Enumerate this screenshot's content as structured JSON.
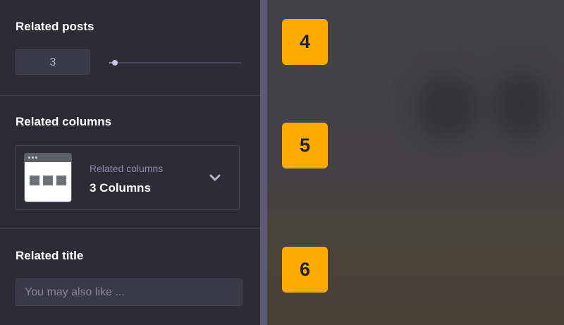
{
  "sections": {
    "related_posts": {
      "heading": "Related posts",
      "count_value": "3",
      "slider_level": 0.04
    },
    "related_columns": {
      "heading": "Related columns",
      "select_label": "Related columns",
      "select_value": "3 Columns",
      "icon": "three-column-layout-icon",
      "chevron_icon": "chevron-down-icon"
    },
    "related_title": {
      "heading": "Related title",
      "placeholder": "You may also like ..."
    }
  },
  "preview": {
    "badges": [
      "4",
      "5",
      "6"
    ],
    "badge_color": "#fdab00"
  },
  "colors": {
    "sidebar_bg": "#2c2b36",
    "accent_slider": "#c8c6ee",
    "divider": "#5d5b77"
  }
}
